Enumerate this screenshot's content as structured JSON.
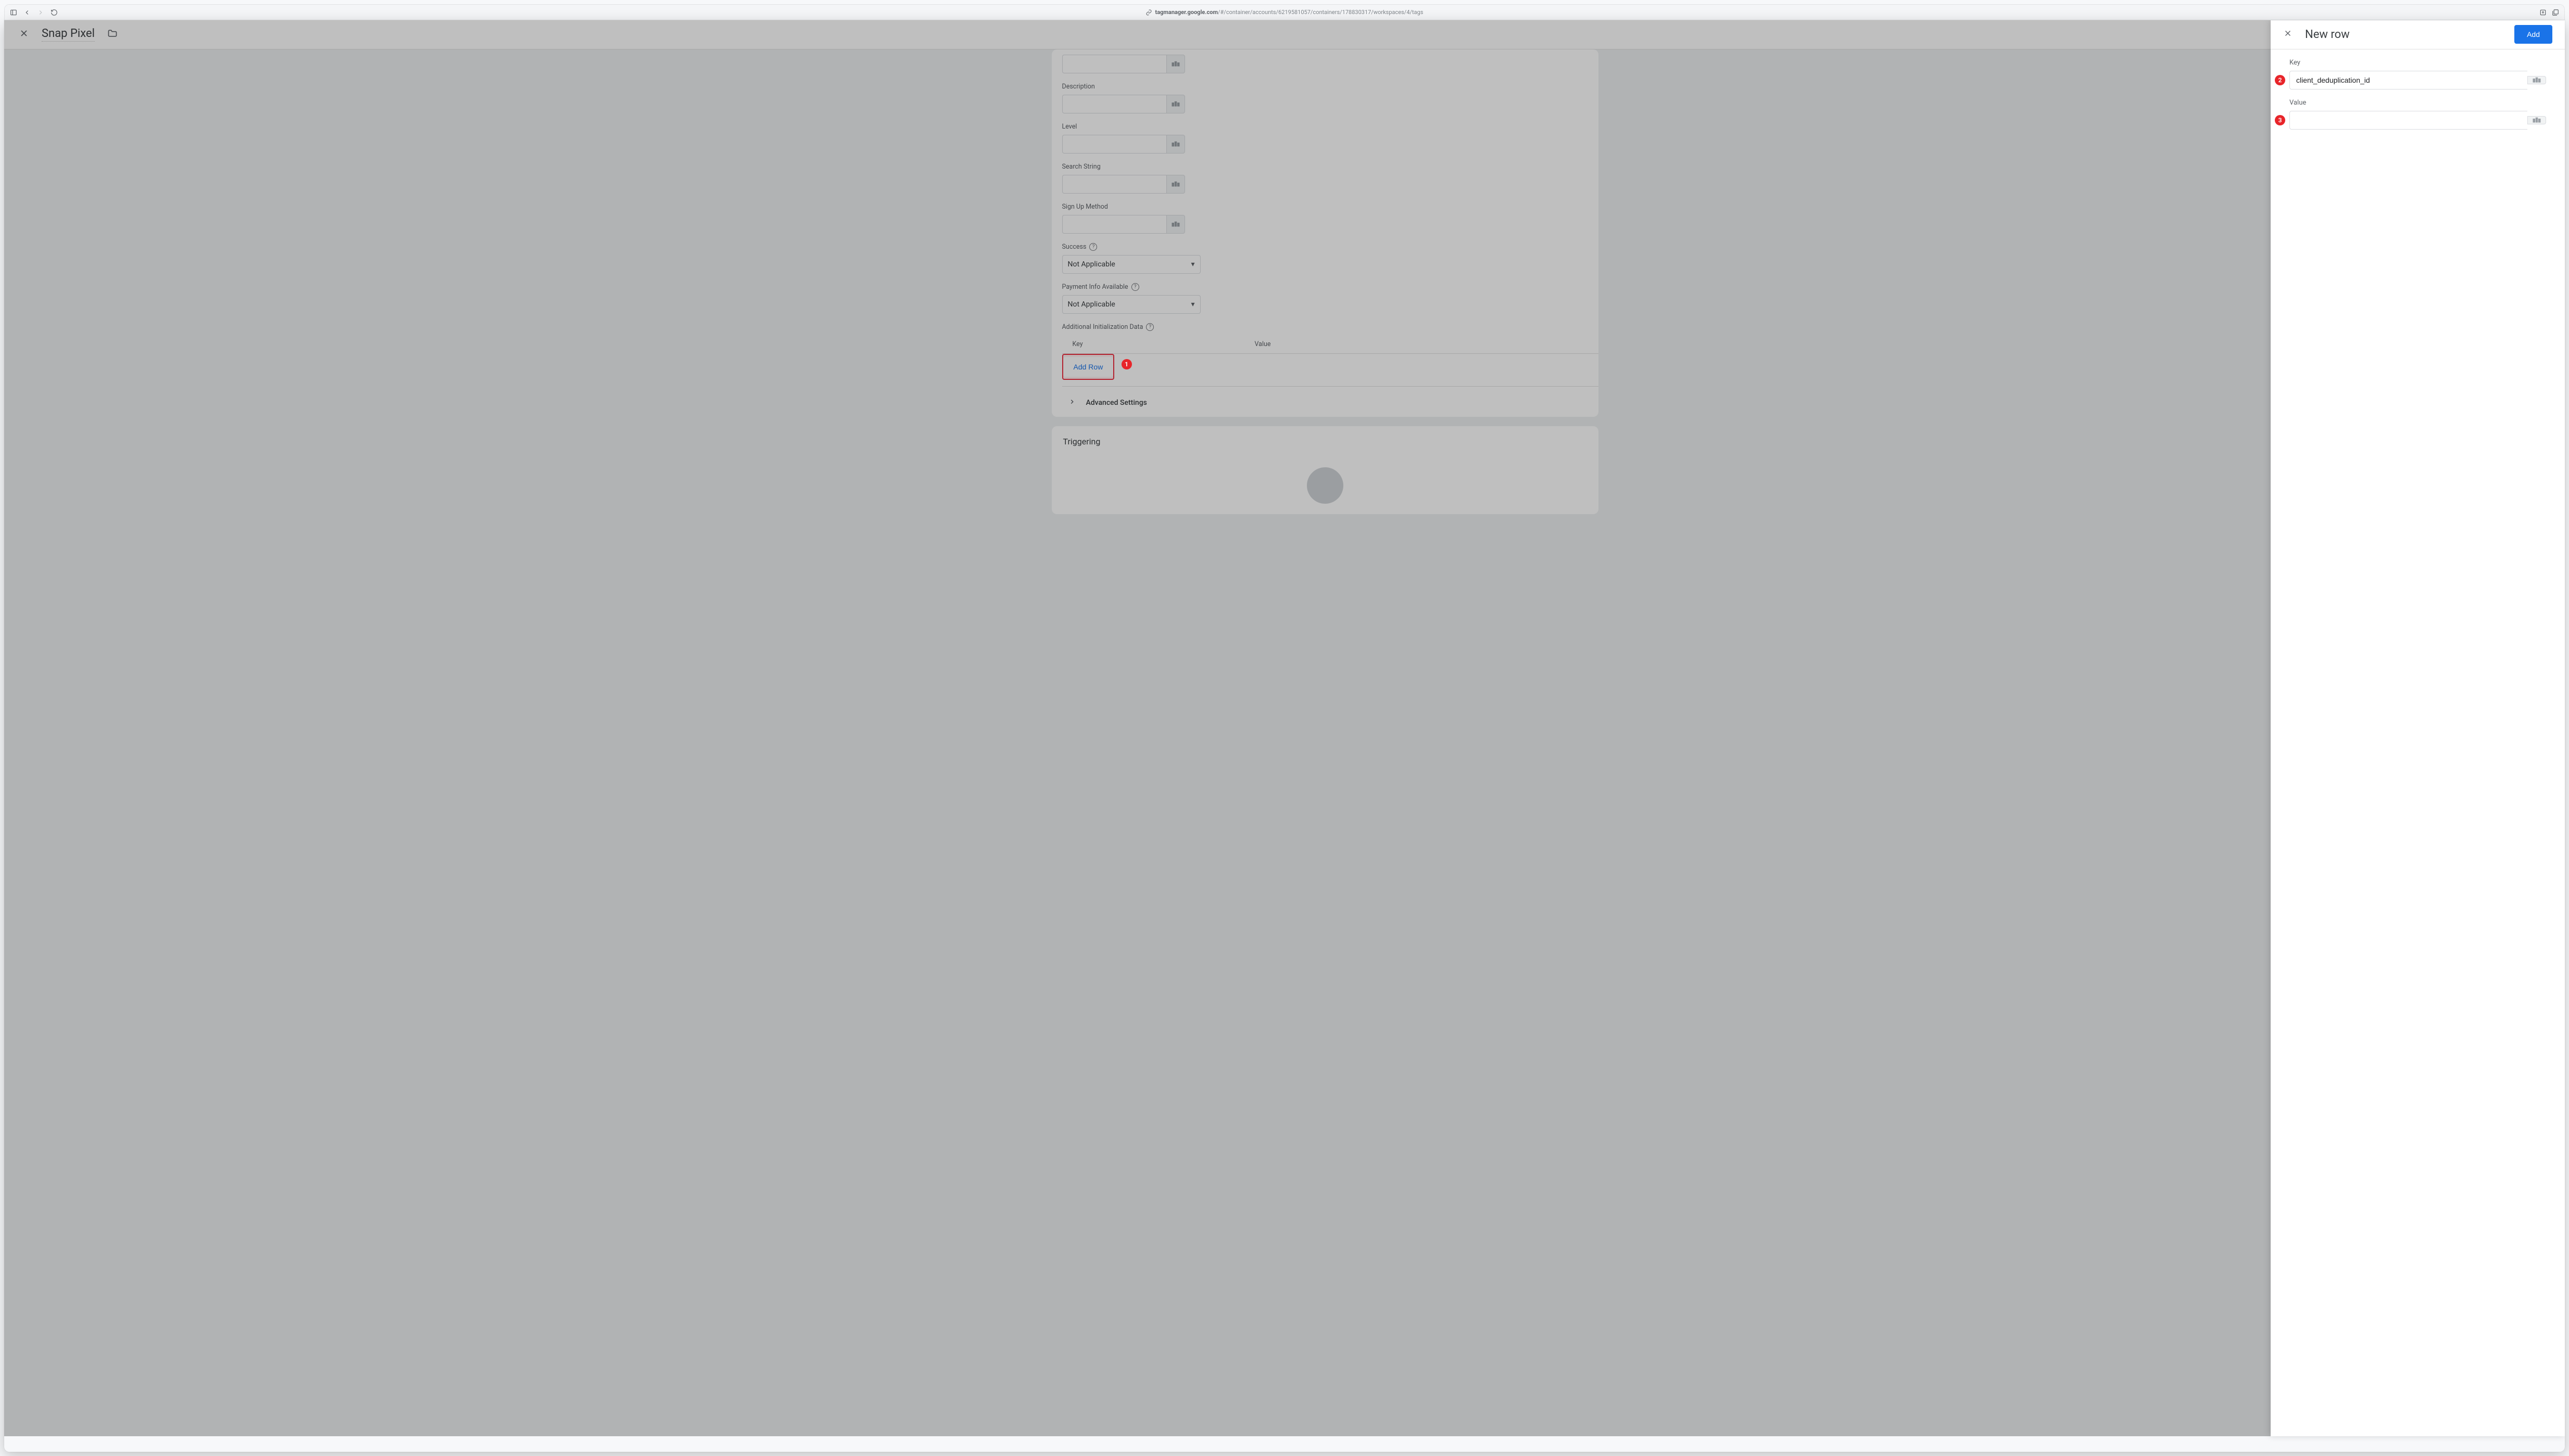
{
  "chrome": {
    "url_host": "tagmanager.google.com",
    "url_path": "/#/container/accounts/6219581057/containers/178830317/workspaces/4/tags"
  },
  "tag_header": {
    "title": "Snap Pixel"
  },
  "form": {
    "field_blank": "",
    "description_label": "Description",
    "level_label": "Level",
    "search_string_label": "Search String",
    "sign_up_label": "Sign Up Method",
    "success_label": "Success",
    "payment_label": "Payment Info Available",
    "select_not_applicable": "Not Applicable",
    "additional_label": "Additional Initialization Data",
    "col_key": "Key",
    "col_value": "Value",
    "add_row": "Add Row",
    "advanced": "Advanced Settings"
  },
  "triggering": {
    "title": "Triggering"
  },
  "callouts": {
    "c1": "1",
    "c2": "2",
    "c3": "3"
  },
  "panel": {
    "title": "New row",
    "add_btn": "Add",
    "key_label": "Key",
    "key_value": "client_deduplication_id",
    "value_label": "Value",
    "value_value": ""
  }
}
